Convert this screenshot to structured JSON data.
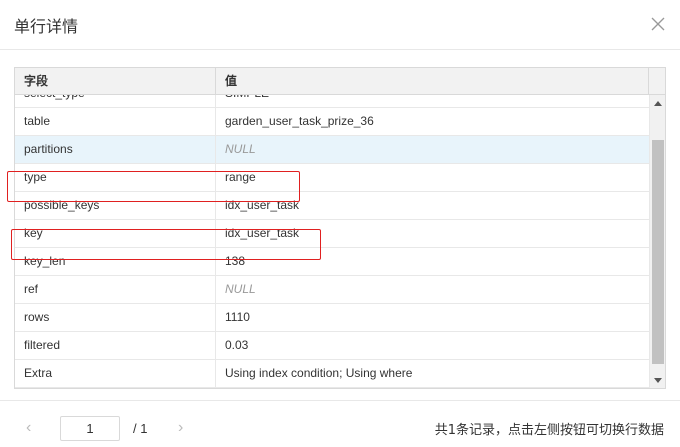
{
  "dialog": {
    "title": "单行详情",
    "close_icon": "close-icon"
  },
  "table": {
    "columns": [
      "字段",
      "值"
    ],
    "rows": [
      {
        "field": "select_type",
        "value": "SIMPLE",
        "is_null": false
      },
      {
        "field": "table",
        "value": "garden_user_task_prize_36",
        "is_null": false
      },
      {
        "field": "partitions",
        "value": "NULL",
        "is_null": true
      },
      {
        "field": "type",
        "value": "range",
        "is_null": false
      },
      {
        "field": "possible_keys",
        "value": "idx_user_task",
        "is_null": false
      },
      {
        "field": "key",
        "value": "idx_user_task",
        "is_null": false
      },
      {
        "field": "key_len",
        "value": "138",
        "is_null": false
      },
      {
        "field": "ref",
        "value": "NULL",
        "is_null": true
      },
      {
        "field": "rows",
        "value": "1110",
        "is_null": false
      },
      {
        "field": "filtered",
        "value": "0.03",
        "is_null": false
      },
      {
        "field": "Extra",
        "value": "Using index condition; Using where",
        "is_null": false
      }
    ],
    "highlight_color": "#e8f4fb",
    "annotation_color": "#e02020"
  },
  "pager": {
    "current_page": "1",
    "total_label": "/ 1",
    "prev_icon": "chevron-left-icon",
    "next_icon": "chevron-right-icon"
  },
  "footer": {
    "hint": "共1条记录，点击左侧按钮可切换行数据"
  }
}
